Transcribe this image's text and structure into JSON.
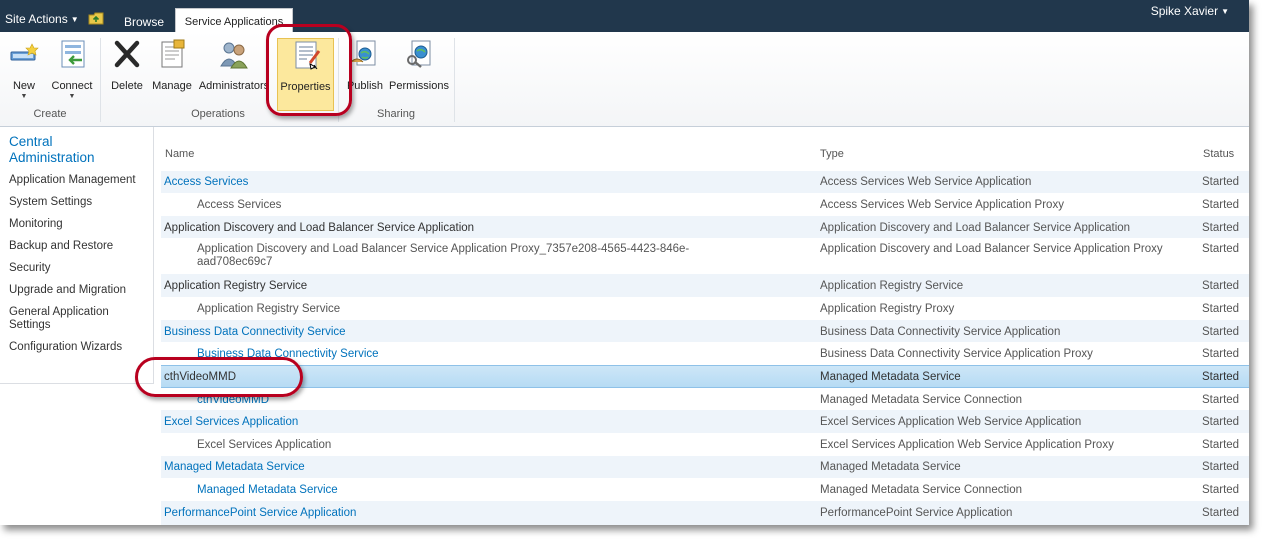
{
  "topbar": {
    "site_actions": "Site Actions",
    "tab_browse": "Browse",
    "tab_active": "Service Applications",
    "user": "Spike Xavier"
  },
  "ribbon": {
    "buttons": {
      "new": "New",
      "connect": "Connect",
      "delete": "Delete",
      "manage": "Manage",
      "administrators": "Administrators",
      "properties": "Properties",
      "publish": "Publish",
      "permissions": "Permissions"
    },
    "groups": {
      "create": "Create",
      "operations": "Operations",
      "sharing": "Sharing"
    }
  },
  "leftnav": {
    "title_line1": "Central",
    "title_line2": "Administration",
    "items": [
      "Application Management",
      "System Settings",
      "Monitoring",
      "Backup and Restore",
      "Security",
      "Upgrade and Migration",
      "General Application",
      "Settings",
      "Configuration Wizards"
    ]
  },
  "table": {
    "headers": {
      "name": "Name",
      "type": "Type",
      "status": "Status"
    },
    "rows": [
      {
        "name": "Access Services",
        "type": "Access Services Web Service Application",
        "status": "Started"
      },
      {
        "name": "Access Services",
        "type": "Access Services Web Service Application Proxy",
        "status": "Started"
      },
      {
        "name": "Application Discovery and Load Balancer Service Application",
        "type": "Application Discovery and Load Balancer Service Application",
        "status": "Started"
      },
      {
        "name": "Application Discovery and Load Balancer Service Application Proxy_7357e208-4565-4423-846e-aad708ec69c7",
        "type": "Application Discovery and Load Balancer Service Application Proxy",
        "status": "Started"
      },
      {
        "name": "Application Registry Service",
        "type": "Application Registry Service",
        "status": "Started"
      },
      {
        "name": "Application Registry Service",
        "type": "Application Registry Proxy",
        "status": "Started"
      },
      {
        "name": "Business Data Connectivity Service",
        "type": "Business Data Connectivity Service Application",
        "status": "Started"
      },
      {
        "name": "Business Data Connectivity Service",
        "type": "Business Data Connectivity Service Application Proxy",
        "status": "Started"
      },
      {
        "name": "cthVideoMMD",
        "type": "Managed Metadata Service",
        "status": "Started"
      },
      {
        "name": "cthVideoMMD",
        "type": "Managed Metadata Service Connection",
        "status": "Started"
      },
      {
        "name": "Excel Services Application",
        "type": "Excel Services Application Web Service Application",
        "status": "Started"
      },
      {
        "name": "Excel Services Application",
        "type": "Excel Services Application Web Service Application Proxy",
        "status": "Started"
      },
      {
        "name": "Managed Metadata Service",
        "type": "Managed Metadata Service",
        "status": "Started"
      },
      {
        "name": "Managed Metadata Service",
        "type": "Managed Metadata Service Connection",
        "status": "Started"
      },
      {
        "name": "PerformancePoint Service Application",
        "type": "PerformancePoint Service Application",
        "status": "Started"
      }
    ]
  },
  "colors": {
    "topbar": "#21374c",
    "link": "#0072bc",
    "selected_row": "#b6dbf4",
    "callout": "#b8001f",
    "properties_highlight": "#fce89d"
  }
}
